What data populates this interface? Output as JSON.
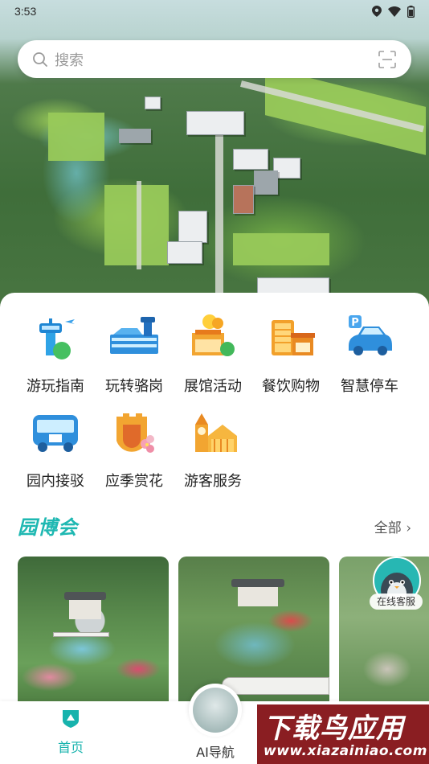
{
  "status_bar": {
    "time": "3:53",
    "icons": [
      "location-icon",
      "wifi-icon",
      "battery-icon"
    ]
  },
  "search": {
    "placeholder": "搜索",
    "icons": [
      "search-icon",
      "scan-icon"
    ]
  },
  "quick_links": [
    {
      "label": "游玩指南",
      "icon": "control-tower-icon"
    },
    {
      "label": "玩转骆岗",
      "icon": "terminal-building-icon"
    },
    {
      "label": "展馆活动",
      "icon": "balloon-pavilion-icon"
    },
    {
      "label": "餐饮购物",
      "icon": "shopping-building-icon"
    },
    {
      "label": "智慧停车",
      "icon": "parking-car-icon"
    },
    {
      "label": "园内接驳",
      "icon": "shuttle-bus-icon"
    },
    {
      "label": "应季赏花",
      "icon": "flower-wall-icon"
    },
    {
      "label": "游客服务",
      "icon": "clock-tower-icon"
    }
  ],
  "section": {
    "title": "园博会",
    "more": "全部"
  },
  "cards": [
    {
      "name": "garden-photo-1"
    },
    {
      "name": "garden-photo-2"
    },
    {
      "name": "garden-photo-3"
    }
  ],
  "customer_service": {
    "label": "在线客服"
  },
  "bottom_nav": {
    "home": "首页",
    "ai": "AI导航"
  },
  "watermark": {
    "title": "下载鸟应用",
    "url": "www.xiazainiao.com"
  },
  "colors": {
    "accent": "#17b3ad",
    "section_title": "#1fb8b2"
  }
}
